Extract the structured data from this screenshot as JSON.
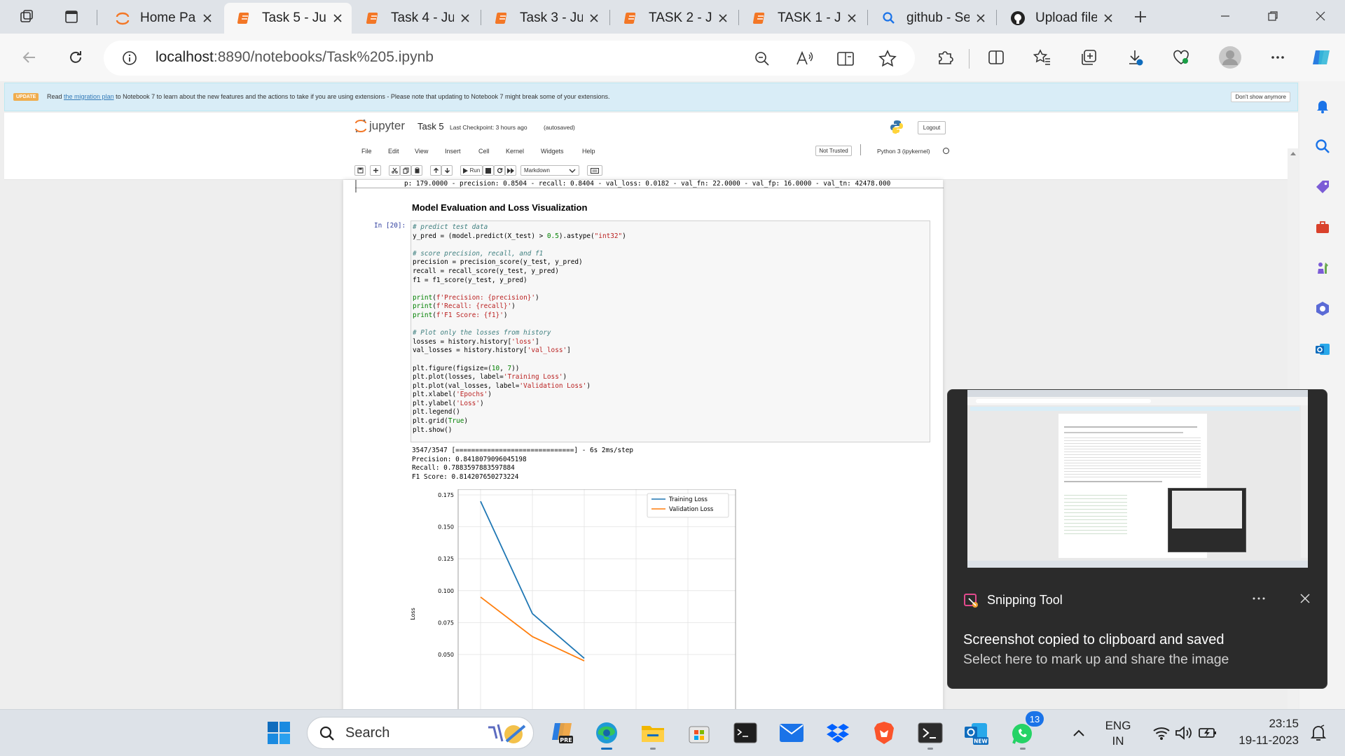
{
  "tabs": [
    {
      "title": "Home Pag",
      "icon": "jupyter-logo-icon",
      "active": false
    },
    {
      "title": "Task 5 - Ju",
      "icon": "notebook-icon",
      "active": true
    },
    {
      "title": "Task 4 - Ju",
      "icon": "notebook-icon",
      "active": false
    },
    {
      "title": "Task 3 - Ju",
      "icon": "notebook-icon",
      "active": false
    },
    {
      "title": "TASK 2 - Ju",
      "icon": "notebook-icon",
      "active": false
    },
    {
      "title": "TASK 1 - Ju",
      "icon": "notebook-icon",
      "active": false
    },
    {
      "title": "github - Se",
      "icon": "search-icon",
      "active": false
    },
    {
      "title": "Upload file",
      "icon": "github-icon",
      "active": false
    }
  ],
  "address": {
    "host": "localhost",
    "rest": ":8890/notebooks/Task%205.ipynb"
  },
  "banner": {
    "badge": "UPDATE",
    "pre": "Read",
    "link": "the migration plan",
    "post": "to Notebook 7 to learn about the new features and the actions to take if you are using extensions - Please note that updating to Notebook 7 might break some of your extensions.",
    "dismiss": "Don't show anymore"
  },
  "jupyter": {
    "brand": "jupyter",
    "notebook_name": "Task 5",
    "checkpoint": "Last Checkpoint: 3 hours ago",
    "autosaved": "(autosaved)",
    "logout": "Logout",
    "menus": [
      "File",
      "Edit",
      "View",
      "Insert",
      "Cell",
      "Kernel",
      "Widgets",
      "Help"
    ],
    "trust": "Not Trusted",
    "kernel": "Python 3 (ipykernel)",
    "run_label": "Run",
    "cell_type": "Markdown"
  },
  "notebook": {
    "prev_output_line": "p: 179.0000 - precision: 0.8504 - recall: 0.8404 - val_loss: 0.0182 - val_fn: 22.0000 - val_fp: 16.0000 - val_tn: 42478.000",
    "heading": "Model Evaluation and Loss Visualization",
    "prompt": "In [20]:",
    "output": [
      "3547/3547 [==============================] - 6s 2ms/step",
      "Precision: 0.8418079096045198",
      "Recall: 0.7883597883597884",
      "F1 Score: 0.814207650273224"
    ]
  },
  "chart_data": {
    "type": "line",
    "title": "",
    "xlabel": "",
    "ylabel": "Loss",
    "ylim_visible": [
      0.05,
      0.175
    ],
    "yticks": [
      "0.175",
      "0.150",
      "0.125",
      "0.100",
      "0.075",
      "0.050"
    ],
    "grid": true,
    "legend_position": "top-right",
    "series": [
      {
        "name": "Training Loss",
        "color": "#1f77b4",
        "x": [
          0,
          1,
          2
        ],
        "values": [
          0.17,
          0.082,
          0.047
        ]
      },
      {
        "name": "Validation Loss",
        "color": "#ff7f0e",
        "x": [
          0,
          1,
          2
        ],
        "values": [
          0.095,
          0.064,
          0.045
        ]
      }
    ]
  },
  "notification": {
    "app": "Snipping Tool",
    "line1": "Screenshot copied to clipboard and saved",
    "line2": "Select here to mark up and share the image"
  },
  "taskbar": {
    "search_placeholder": "Search",
    "whatsapp_badge": "13",
    "lang1": "ENG",
    "lang2": "IN",
    "time": "23:15",
    "date": "19-11-2023"
  }
}
